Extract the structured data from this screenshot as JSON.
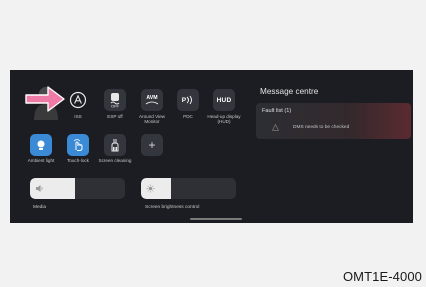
{
  "screen": {
    "tiles_row1": [
      {
        "name": "iss",
        "label": "ISS",
        "icon": "iss-a-circle-icon"
      },
      {
        "name": "esp-off",
        "label": "ESP off",
        "icon": "esp-off-car-icon"
      },
      {
        "name": "avm",
        "label": "Around View Monitor",
        "icon": "avm-icon",
        "icon_text": "AVM"
      },
      {
        "name": "pdc",
        "label": "PDC",
        "icon": "parking-sensor-icon",
        "icon_text": "P"
      },
      {
        "name": "hud",
        "label": "Head-up display (HUD)",
        "icon": "hud-icon",
        "icon_text": "HUD"
      }
    ],
    "tiles_row2": [
      {
        "name": "ambient-light",
        "label": "Ambient light",
        "icon": "ambient-light-icon"
      },
      {
        "name": "touch-lock",
        "label": "Touch-lock",
        "icon": "touch-lock-hand-icon"
      },
      {
        "name": "screen-cleaning",
        "label": "Screen cleaning",
        "icon": "screen-cleaning-icon"
      },
      {
        "name": "add",
        "label": "",
        "icon": "plus-icon",
        "icon_text": "+"
      }
    ],
    "sliders": [
      {
        "name": "media",
        "label": "Media",
        "icon": "volume-icon",
        "level": 0.47
      },
      {
        "name": "screen-brightness",
        "label": "Screen brightness control",
        "icon": "brightness-icon",
        "level": 0.32
      }
    ],
    "message_centre": {
      "title": "Message centre",
      "fault_header": "Fault list (1)",
      "fault_item": "DMS needs to be checked",
      "fault_icon": "warning-icon"
    }
  },
  "figure_code": "OMT1E-4000",
  "colors": {
    "accent_blue": "#3a8ad6",
    "arrow_pink": "#f07aa6",
    "fault_red": "#5a2a30"
  }
}
